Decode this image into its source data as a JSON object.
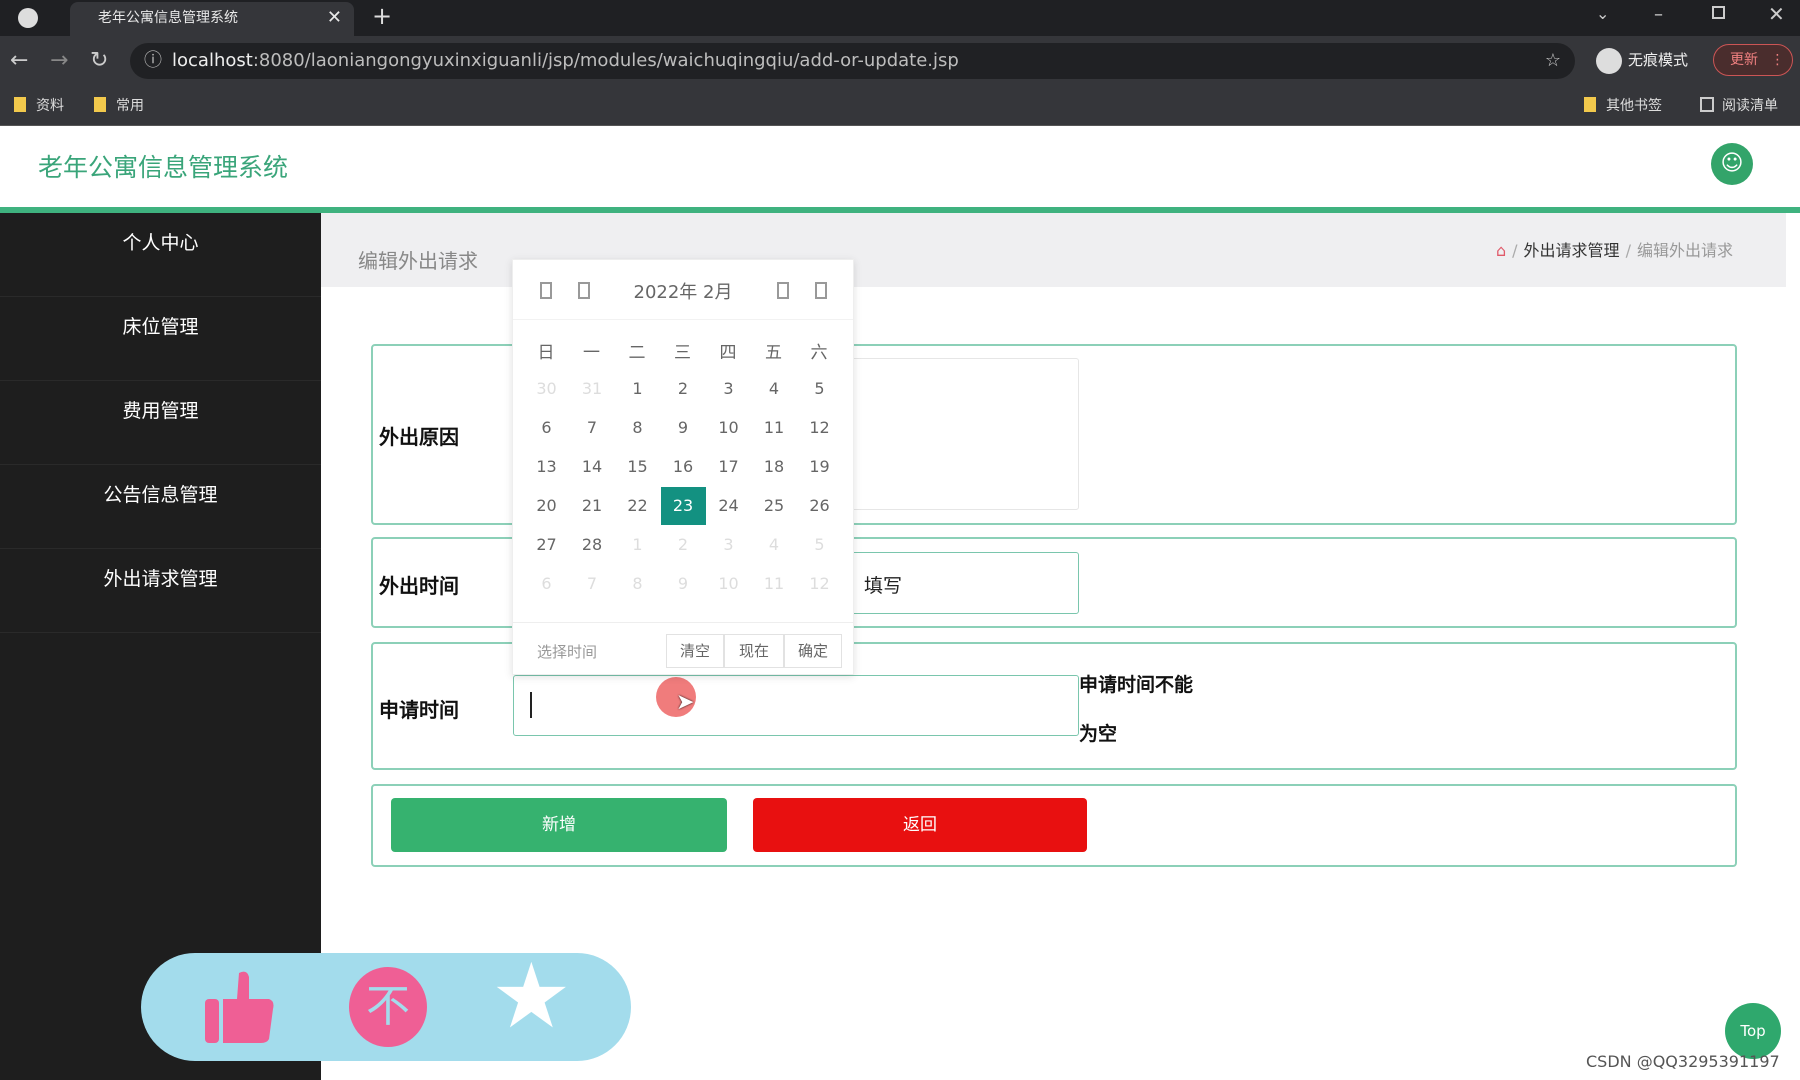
{
  "browser": {
    "tab_title": "老年公寓信息管理系统",
    "url_host": "localhost",
    "url_rest": ":8080/laoniangongyuxinxiguanli/jsp/modules/waichuqingqiu/add-or-update.jsp",
    "incognito_label": "无痕模式",
    "update_label": "更新",
    "bookmarks": [
      "资料",
      "常用"
    ],
    "other_bookmarks": "其他书签",
    "reading_list": "阅读清单"
  },
  "app": {
    "title": "老年公寓信息管理系统"
  },
  "sidebar": {
    "items": [
      {
        "label": "个人中心"
      },
      {
        "label": "床位管理"
      },
      {
        "label": "费用管理"
      },
      {
        "label": "公告信息管理"
      },
      {
        "label": "外出请求管理"
      }
    ]
  },
  "page": {
    "title": "编辑外出请求",
    "breadcrumb": [
      "外出请求管理",
      "编辑外出请求"
    ]
  },
  "form": {
    "reason_label": "外出原因",
    "out_time_label": "外出时间",
    "out_time_partial_text": "填写",
    "apply_time_label": "申请时间",
    "apply_time_error_line1": "申请时间不能",
    "apply_time_error_line2": "为空",
    "add_button": "新增",
    "back_button": "返回"
  },
  "calendar": {
    "year_month": "2022年  2月",
    "weekdays": [
      "日",
      "一",
      "二",
      "三",
      "四",
      "五",
      "六"
    ],
    "selected": "23",
    "rows": [
      [
        [
          "30",
          1
        ],
        [
          "31",
          1
        ],
        [
          "1",
          0
        ],
        [
          "2",
          0
        ],
        [
          "3",
          0
        ],
        [
          "4",
          0
        ],
        [
          "5",
          0
        ]
      ],
      [
        [
          "6",
          0
        ],
        [
          "7",
          0
        ],
        [
          "8",
          0
        ],
        [
          "9",
          0
        ],
        [
          "10",
          0
        ],
        [
          "11",
          0
        ],
        [
          "12",
          0
        ]
      ],
      [
        [
          "13",
          0
        ],
        [
          "14",
          0
        ],
        [
          "15",
          0
        ],
        [
          "16",
          0
        ],
        [
          "17",
          0
        ],
        [
          "18",
          0
        ],
        [
          "19",
          0
        ]
      ],
      [
        [
          "20",
          0
        ],
        [
          "21",
          0
        ],
        [
          "22",
          0
        ],
        [
          "23",
          0
        ],
        [
          "24",
          0
        ],
        [
          "25",
          0
        ],
        [
          "26",
          0
        ]
      ],
      [
        [
          "27",
          0
        ],
        [
          "28",
          0
        ],
        [
          "1",
          1
        ],
        [
          "2",
          1
        ],
        [
          "3",
          1
        ],
        [
          "4",
          1
        ],
        [
          "5",
          1
        ]
      ],
      [
        [
          "6",
          1
        ],
        [
          "7",
          1
        ],
        [
          "8",
          1
        ],
        [
          "9",
          1
        ],
        [
          "10",
          1
        ],
        [
          "11",
          1
        ],
        [
          "12",
          1
        ]
      ]
    ],
    "select_time": "选择时间",
    "clear": "清空",
    "now": "现在",
    "confirm": "确定"
  },
  "floating": {
    "top_label": "Top"
  },
  "watermark": "CSDN @QQ3295391197",
  "colors": {
    "accent": "#3fb27f",
    "add": "#36b26f",
    "back": "#e81010",
    "selected_day": "#139181",
    "floatbar": "#a3dcec",
    "pink": "#ef5f95"
  }
}
